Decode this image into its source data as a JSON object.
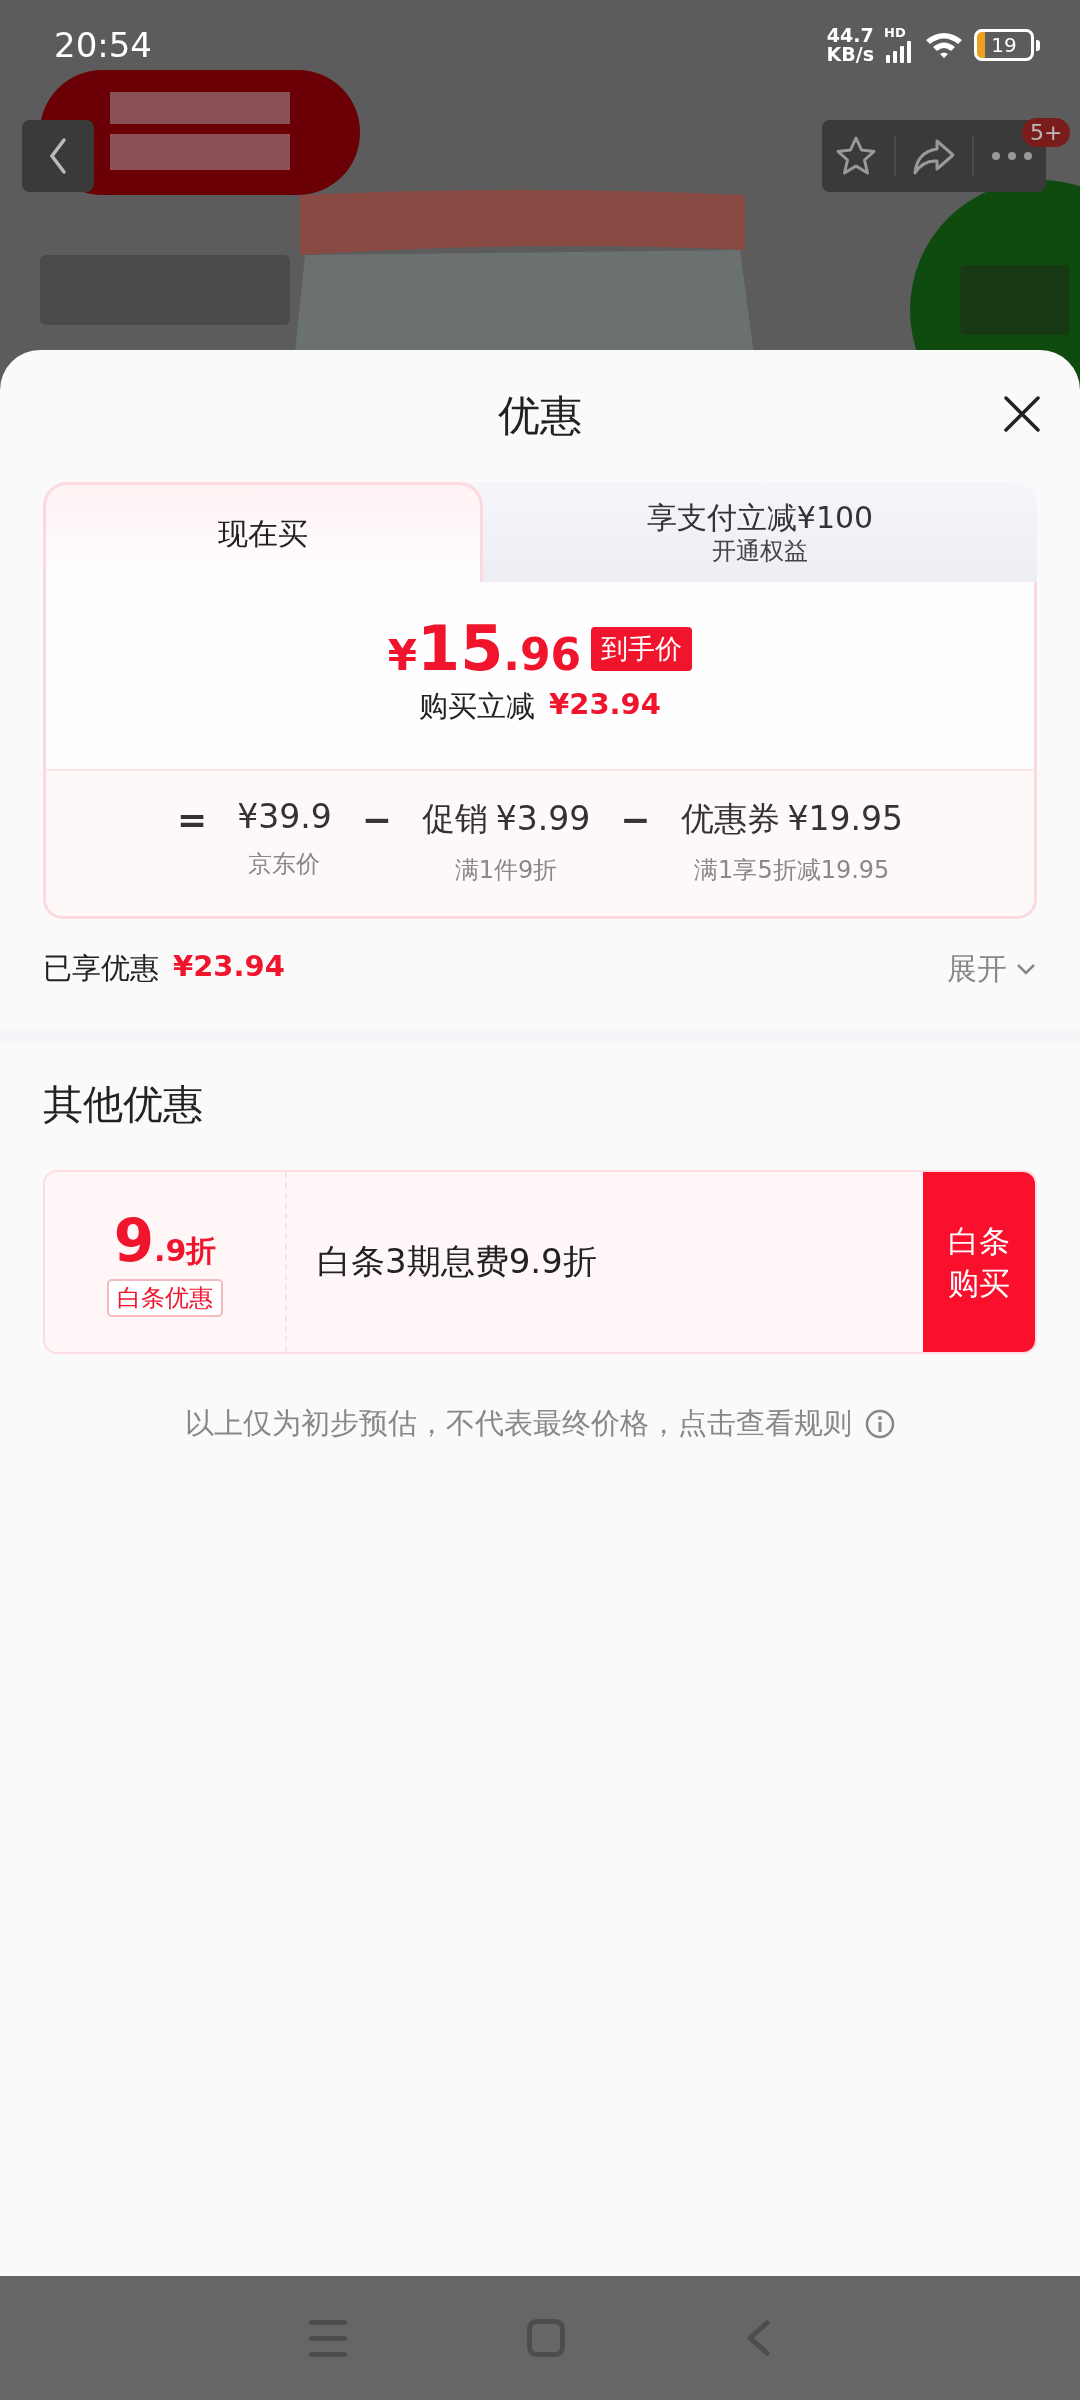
{
  "status_bar": {
    "time": "20:54",
    "net_speed": "44.7",
    "net_unit": "KB/s",
    "network_type": "HD",
    "battery": "19"
  },
  "product_header": {
    "badge": "5+"
  },
  "sheet": {
    "title": "优惠",
    "tabs": [
      {
        "label": "现在买",
        "selected": true
      },
      {
        "label": "享支付立减¥100",
        "sublabel": "开通权益",
        "selected": false
      }
    ],
    "price": {
      "currency": "¥",
      "integer": "15",
      "decimal": ".96",
      "tag": "到手价",
      "saving_label": "购买立减",
      "saving_amount": "¥23.94"
    },
    "breakdown": [
      {
        "operator": "=",
        "amount": "¥39.9",
        "caption": "京东价"
      },
      {
        "operator": "−",
        "label": "促销",
        "amount": "¥3.99",
        "caption": "满1件9折"
      },
      {
        "operator": "−",
        "label": "优惠券",
        "amount": "¥19.95",
        "caption": "满1享5折减19.95"
      }
    ],
    "enjoyed": {
      "label": "已享优惠",
      "amount": "¥23.94"
    },
    "expand": {
      "label": "展开",
      "expanded": false
    },
    "other_title": "其他优惠",
    "offers": [
      {
        "discount_int": "9",
        "discount_rest": ".9折",
        "tag": "白条优惠",
        "description": "白条3期息费9.9折",
        "action": "白条购买"
      }
    ],
    "disclaimer": "以上仅为初步预估，不代表最终价格，点击查看规则"
  }
}
